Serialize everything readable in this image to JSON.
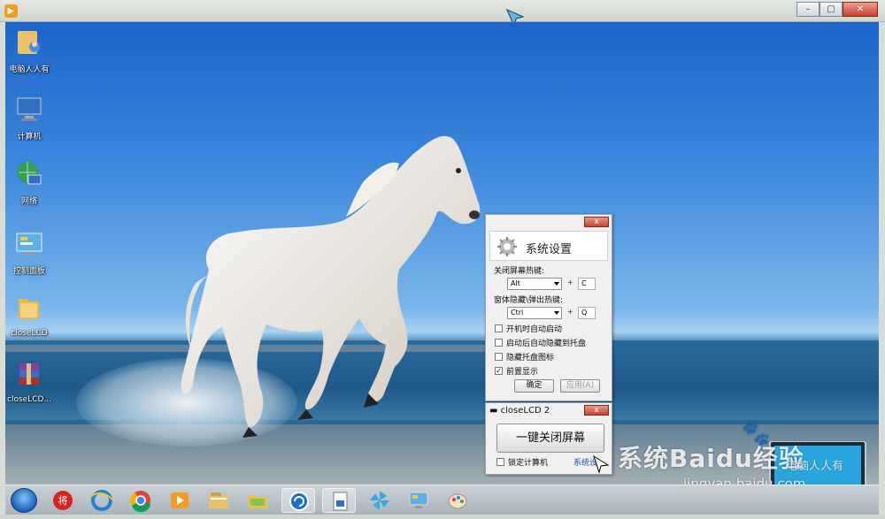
{
  "desktop_icons": [
    {
      "label": "电脑人人有",
      "icon": "user-folder-icon"
    },
    {
      "label": "计算机",
      "icon": "computer-icon"
    },
    {
      "label": "网络",
      "icon": "network-globe-icon"
    },
    {
      "label": "控制面板",
      "icon": "control-panel-icon"
    },
    {
      "label": "closeLCD",
      "icon": "folder-icon"
    },
    {
      "label": "closeLCD...",
      "icon": "winrar-archive-icon"
    }
  ],
  "settings_dialog": {
    "title": "系统设置",
    "close_label": "x",
    "hotkey_close_screen_label": "关闭屏幕热键:",
    "hotkey_close_modifier": "Alt",
    "hotkey_close_key": "C",
    "hotkey_window_label": "窗体隐藏\\弹出热键:",
    "hotkey_window_modifier": "Ctrl",
    "hotkey_window_key": "Q",
    "plus": "+",
    "options": [
      {
        "label": "开机时自动启动",
        "checked": false
      },
      {
        "label": "启动后自动隐藏到托盘",
        "checked": false
      },
      {
        "label": "隐藏托盘图标",
        "checked": false
      },
      {
        "label": "前置显示",
        "checked": true
      }
    ],
    "ok_label": "确定",
    "apply_label": "应用(A)"
  },
  "mini_window": {
    "title": "closeLCD 2",
    "close_label": "x",
    "main_button_label": "一键关闭屏幕",
    "lock_label": "锁定计算机",
    "settings_link": "系统设"
  },
  "watermark": {
    "brand": "系统Baidu经验",
    "url": "jingyan.baidu.com",
    "tag": "电脑人人有"
  },
  "taskbar_items": [
    "start-orb-icon",
    "app-red-icon",
    "internet-explorer-icon",
    "chrome-icon",
    "media-player-icon",
    "file-explorer-icon",
    "folder-green-icon",
    "closelcd-app-icon",
    "document-app-icon",
    "pinwheel-app-icon",
    "remote-desktop-icon",
    "paint-app-icon"
  ],
  "colors": {
    "accent_close": "#c5452f",
    "sky": "#1d64c9"
  }
}
